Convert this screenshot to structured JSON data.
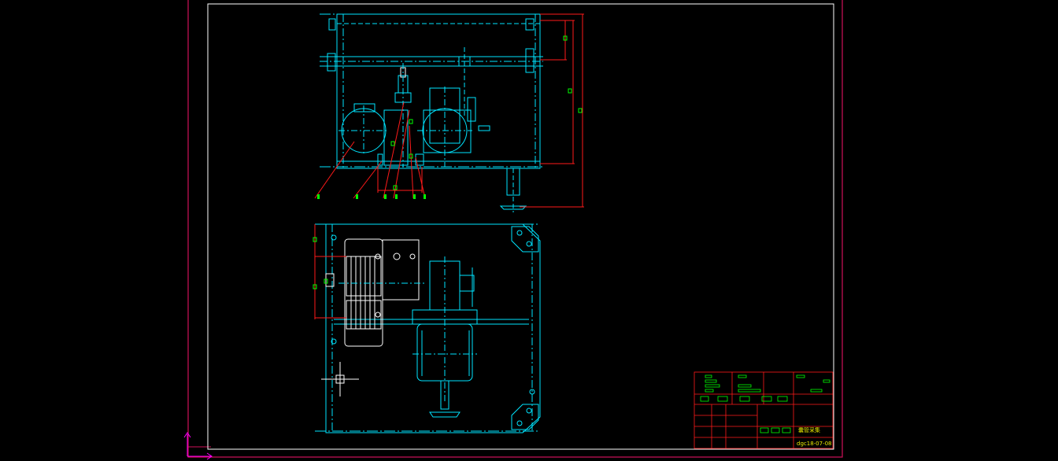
{
  "drawing": {
    "title_label": "囊管采集",
    "drawing_number": "dgc18-07-08",
    "leader_numbers": [
      "1",
      "2",
      "3",
      "4",
      "5",
      "6"
    ]
  },
  "colors": {
    "background": "#000000",
    "outer_border": "#d0105a",
    "inner_border": "#ffffff",
    "component": "#00e5ff",
    "component_white": "#ffffff",
    "dimension": "#ff1a1a",
    "marker": "#00ff00",
    "ucs": "#ff00ff",
    "title_text": "#ffff00"
  },
  "icons": {
    "ucs": "ucs-axis-icon",
    "crosshair": "crosshair-cursor-icon"
  }
}
